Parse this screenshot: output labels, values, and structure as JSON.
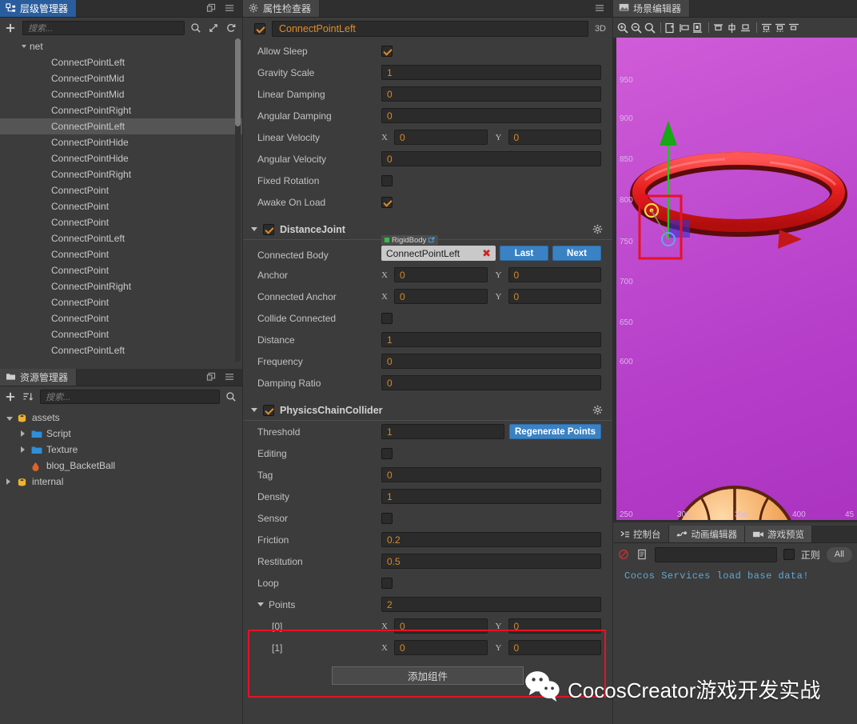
{
  "hierarchy": {
    "tab_label": "层级管理器",
    "tab_icon": "hierarchy-icon",
    "search_placeholder": "搜索...",
    "add_icon": "plus-icon",
    "search_icon": "search-icon",
    "expand_icon": "expand-arrows-icon",
    "refresh_icon": "refresh-icon",
    "popout_icon": "popout-icon",
    "menu_icon": "hamburger-menu-icon",
    "root": "net",
    "nodes": [
      {
        "label": "ConnectPointLeft",
        "selected": false
      },
      {
        "label": "ConnectPointMid",
        "selected": false
      },
      {
        "label": "ConnectPointMid",
        "selected": false
      },
      {
        "label": "ConnectPointRight",
        "selected": false
      },
      {
        "label": "ConnectPointLeft",
        "selected": true
      },
      {
        "label": "ConnectPointHide",
        "selected": false
      },
      {
        "label": "ConnectPointHide",
        "selected": false
      },
      {
        "label": "ConnectPointRight",
        "selected": false
      },
      {
        "label": "ConnectPoint",
        "selected": false
      },
      {
        "label": "ConnectPoint",
        "selected": false
      },
      {
        "label": "ConnectPoint",
        "selected": false
      },
      {
        "label": "ConnectPointLeft",
        "selected": false
      },
      {
        "label": "ConnectPoint",
        "selected": false
      },
      {
        "label": "ConnectPoint",
        "selected": false
      },
      {
        "label": "ConnectPointRight",
        "selected": false
      },
      {
        "label": "ConnectPoint",
        "selected": false
      },
      {
        "label": "ConnectPoint",
        "selected": false
      },
      {
        "label": "ConnectPoint",
        "selected": false
      },
      {
        "label": "ConnectPointLeft",
        "selected": false
      }
    ]
  },
  "assets": {
    "tab_label": "资源管理器",
    "tab_icon": "folder-icon",
    "search_placeholder": "搜索...",
    "add_icon": "plus-icon",
    "sort_icon": "sort-icon",
    "search_icon": "search-icon",
    "popout_icon": "popout-icon",
    "menu_icon": "hamburger-menu-icon",
    "tree": [
      {
        "label": "assets",
        "depth": 0,
        "icon": "db-icon",
        "arrow": "open"
      },
      {
        "label": "Script",
        "depth": 1,
        "icon": "folder-icon",
        "arrow": "closed"
      },
      {
        "label": "Texture",
        "depth": 1,
        "icon": "folder-icon",
        "arrow": "closed"
      },
      {
        "label": "blog_BacketBall",
        "depth": 1,
        "icon": "scene-icon",
        "arrow": "none"
      },
      {
        "label": "internal",
        "depth": 0,
        "icon": "db-icon",
        "arrow": "closed"
      }
    ]
  },
  "inspector": {
    "tab_label": "属性检查器",
    "tab_icon": "gear-icon",
    "menu_icon": "hamburger-menu-icon",
    "node_name": "ConnectPointLeft",
    "node_enabled": true,
    "mode_label": "3D",
    "rigidbody_props": [
      {
        "label": "Allow Sleep",
        "type": "check",
        "value": true
      },
      {
        "label": "Gravity Scale",
        "type": "num",
        "value": "1"
      },
      {
        "label": "Linear Damping",
        "type": "num",
        "value": "0"
      },
      {
        "label": "Angular Damping",
        "type": "num",
        "value": "0"
      },
      {
        "label": "Linear Velocity",
        "type": "xy",
        "x": "0",
        "y": "0"
      },
      {
        "label": "Angular Velocity",
        "type": "num",
        "value": "0"
      },
      {
        "label": "Fixed Rotation",
        "type": "check",
        "value": false
      },
      {
        "label": "Awake On Load",
        "type": "check",
        "value": true
      }
    ],
    "distance_joint": {
      "title": "DistanceJoint",
      "enabled": true,
      "gear_icon": "gear-icon",
      "connected_body_label": "Connected Body",
      "connected_body_value": "ConnectPointLeft",
      "connected_body_type": "RigidBody",
      "link_icon": "external-link-icon",
      "clear_icon": "close-x-icon",
      "last_button": "Last",
      "next_button": "Next",
      "props": [
        {
          "label": "Anchor",
          "type": "xy",
          "x": "0",
          "y": "0"
        },
        {
          "label": "Connected Anchor",
          "type": "xy",
          "x": "0",
          "y": "0"
        },
        {
          "label": "Collide Connected",
          "type": "check",
          "value": false
        },
        {
          "label": "Distance",
          "type": "num",
          "value": "1"
        },
        {
          "label": "Frequency",
          "type": "num",
          "value": "0"
        },
        {
          "label": "Damping Ratio",
          "type": "num",
          "value": "0"
        }
      ]
    },
    "chain_collider": {
      "title": "PhysicsChainCollider",
      "enabled": true,
      "gear_icon": "gear-icon",
      "threshold_label": "Threshold",
      "threshold_value": "1",
      "regenerate_button": "Regenerate Points",
      "props": [
        {
          "label": "Editing",
          "type": "check",
          "value": false
        },
        {
          "label": "Tag",
          "type": "num",
          "value": "0"
        },
        {
          "label": "Density",
          "type": "num",
          "value": "1"
        },
        {
          "label": "Sensor",
          "type": "check",
          "value": false
        },
        {
          "label": "Friction",
          "type": "num",
          "value": "0.2"
        },
        {
          "label": "Restitution",
          "type": "num",
          "value": "0.5"
        },
        {
          "label": "Loop",
          "type": "check",
          "value": false
        }
      ],
      "points_label": "Points",
      "points_count": "2",
      "points": [
        {
          "index": "[0]",
          "x": "0",
          "y": "0"
        },
        {
          "index": "[1]",
          "x": "0",
          "y": "0"
        }
      ]
    },
    "add_component_label": "添加组件",
    "highlight_color": "#e81123"
  },
  "scene": {
    "tab_label": "场景编辑器",
    "tab_icon": "scene-icon",
    "toolbar_icons": [
      "zoom-in-icon",
      "zoom-out-icon",
      "zoom-reset-icon",
      "align-left-icon",
      "align-center-h-icon",
      "align-right-icon",
      "align-top-icon",
      "align-middle-v-icon",
      "align-bottom-icon",
      "distribute-top-icon",
      "distribute-middle-icon",
      "distribute-bottom-icon"
    ],
    "ruler_y": [
      "950",
      "900",
      "850",
      "800",
      "750",
      "700",
      "650",
      "600"
    ],
    "ruler_x": [
      "250",
      "300",
      "350",
      "400",
      "45"
    ],
    "gizmo_up_arrow": "green-axis-arrow",
    "selection_color": "#e81123"
  },
  "console": {
    "tabs": [
      {
        "label": "控制台",
        "icon": "console-icon",
        "active": true
      },
      {
        "label": "动画编辑器",
        "icon": "anim-icon",
        "active": false
      },
      {
        "label": "游戏预览",
        "icon": "camera-icon",
        "active": false
      }
    ],
    "clear_icon": "clear-circle-icon",
    "copy_icon": "document-icon",
    "filter_value": "",
    "regex_label": "正则",
    "regex_checked": false,
    "level_filter": "All",
    "log_lines": [
      "Cocos Services load base data!"
    ]
  },
  "watermark": {
    "icon": "wechat-icon",
    "text": "CocosCreator游戏开发实战"
  }
}
